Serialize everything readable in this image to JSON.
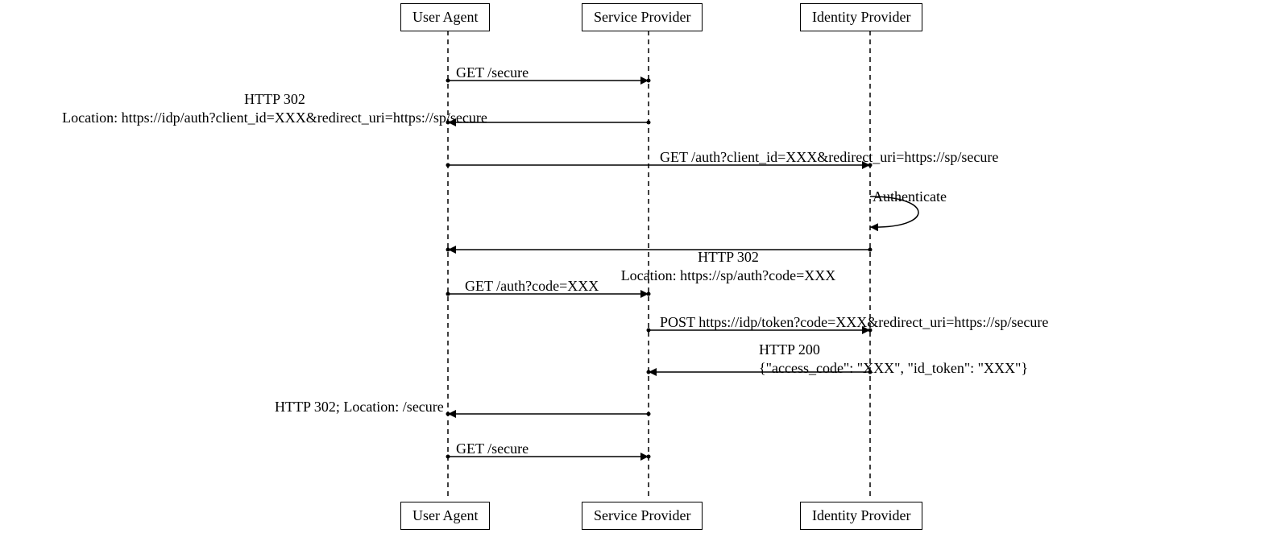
{
  "participants": {
    "ua": "User Agent",
    "sp": "Service Provider",
    "idp": "Identity Provider"
  },
  "messages": {
    "m1": "GET /secure",
    "m2_line1": "HTTP 302",
    "m2_line2": "Location: https://idp/auth?client_id=XXX&redirect_uri=https://sp/secure",
    "m3": "GET /auth?client_id=XXX&redirect_uri=https://sp/secure",
    "m4": "Authenticate",
    "m5_line1": "HTTP 302",
    "m5_line2": "Location: https://sp/auth?code=XXX",
    "m6": "GET /auth?code=XXX",
    "m7": "POST https://idp/token?code=XXX&redirect_uri=https://sp/secure",
    "m8_line1": "HTTP 200",
    "m8_line2": "{\"access_code\": \"XXX\", \"id_token\": \"XXX\"}",
    "m9": "HTTP 302; Location: /secure",
    "m10": "GET /secure"
  }
}
